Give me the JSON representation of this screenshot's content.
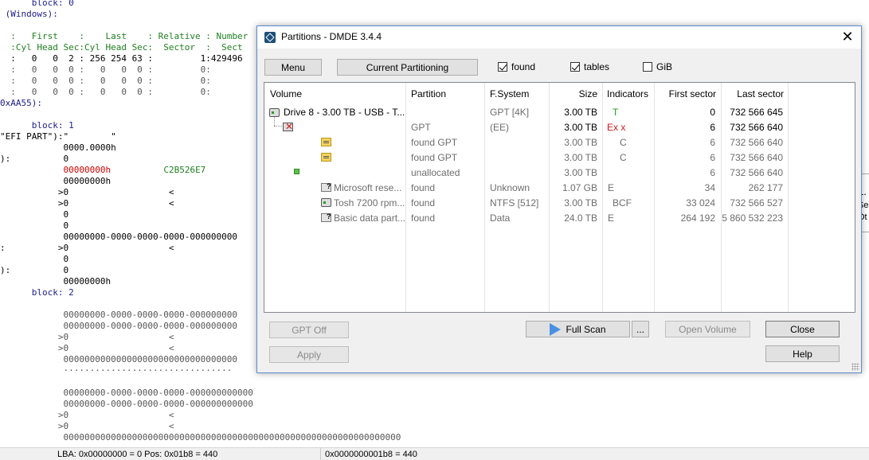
{
  "background": {
    "lines": [
      {
        "t": "      block: 0",
        "cls": "c-navy"
      },
      {
        "t": " (Windows):",
        "cls": "c-navy"
      },
      {
        "t": "",
        "cls": ""
      },
      {
        "t": "  :   First    :    Last    : Relative : Number",
        "cls": "c-green"
      },
      {
        "t": "  :Cyl Head Sec:Cyl Head Sec:  Sector  :  Sect",
        "cls": "c-green"
      },
      {
        "t": "  :   0   0  2 : 256 254 63 :         1:429496",
        "cls": ""
      },
      {
        "t": "  :   0   0  0 :   0   0  0 :         0:",
        "cls": "c-gray"
      },
      {
        "t": "  :   0   0  0 :   0   0  0 :         0:",
        "cls": "c-gray"
      },
      {
        "t": "  :   0   0  0 :   0   0  0 :         0:",
        "cls": "c-gray"
      },
      {
        "t": "0xAA55):",
        "cls": "c-navy"
      },
      {
        "t": "",
        "cls": ""
      },
      {
        "t": "      block: 1",
        "cls": "c-navy"
      },
      {
        "t": "\"EFI PART\"):\"        \"",
        "cls": ""
      },
      {
        "t": "            0000.0000h",
        "cls": ""
      },
      {
        "t": "):          0",
        "cls": ""
      },
      {
        "t": "            00000000h          C2B526E7",
        "cls": "red-line"
      },
      {
        "t": "            00000000h",
        "cls": ""
      },
      {
        "t": "           >0                   <",
        "cls": ""
      },
      {
        "t": "           >0                   <",
        "cls": ""
      },
      {
        "t": "            0",
        "cls": ""
      },
      {
        "t": "            0",
        "cls": ""
      },
      {
        "t": "            00000000-0000-0000-0000-000000000",
        "cls": ""
      },
      {
        "t": ":          >0                   <",
        "cls": ""
      },
      {
        "t": "            0",
        "cls": ""
      },
      {
        "t": "):          0",
        "cls": ""
      },
      {
        "t": "            00000000h",
        "cls": ""
      },
      {
        "t": "      block: 2",
        "cls": "c-navy"
      },
      {
        "t": "",
        "cls": ""
      },
      {
        "t": "            00000000-0000-0000-0000-000000000",
        "cls": "c-gray"
      },
      {
        "t": "            00000000-0000-0000-0000-000000000",
        "cls": "c-gray"
      },
      {
        "t": "           >0                   <",
        "cls": "c-gray"
      },
      {
        "t": "           >0                   <",
        "cls": "c-gray"
      },
      {
        "t": "            000000000000000000000000000000000",
        "cls": "c-gray"
      },
      {
        "t": "            ································",
        "cls": "c-gray"
      },
      {
        "t": "",
        "cls": ""
      },
      {
        "t": "            00000000-0000-0000-0000-000000000000",
        "cls": "c-gray"
      },
      {
        "t": "            00000000-0000-0000-0000-000000000000",
        "cls": "c-gray"
      },
      {
        "t": "           >0                   <",
        "cls": "c-gray"
      },
      {
        "t": "           >0                   <",
        "cls": "c-gray"
      },
      {
        "t": "            0000000000000000000000000000000000000000000000000000000000000000",
        "cls": "c-gray"
      }
    ],
    "status": {
      "lba": "LBA: 0x00000000 = 0  Pos: 0x01b8 = 440",
      "pos": "0x0000000001b8 = 440"
    }
  },
  "tooltip": {
    "title": "1.",
    "line1": "Sel",
    "line2": "Ot"
  },
  "dialog": {
    "title": "Partitions - DMDE 3.4.4",
    "menu_label": "Menu",
    "current_partitioning_label": "Current Partitioning",
    "found_label": "found",
    "tables_label": "tables",
    "gib_label": "GiB",
    "columns": [
      "Volume",
      "Partition",
      "F.System",
      "Size",
      "Indicators",
      "First sector",
      "Last sector"
    ],
    "rows": [
      {
        "volume": "Drive 8 - 3.00 TB - USB - T...",
        "partition": "",
        "fs": "GPT [4K]",
        "size": "3.00 TB",
        "ind": "T",
        "first": "0",
        "last": "732 566 645"
      },
      {
        "volume": "",
        "partition": "GPT",
        "fs": "(EE)",
        "size": "3.00 TB",
        "ind": "Ex x",
        "first": "6",
        "last": "732 566 640"
      },
      {
        "volume": "",
        "partition": "found GPT",
        "fs": "",
        "size": "3.00 TB",
        "ind": "C",
        "first": "6",
        "last": "732 566 640"
      },
      {
        "volume": "",
        "partition": "found GPT",
        "fs": "",
        "size": "3.00 TB",
        "ind": "C",
        "first": "6",
        "last": "732 566 640"
      },
      {
        "volume": "",
        "partition": "unallocated",
        "fs": "",
        "size": "3.00 TB",
        "ind": "",
        "first": "6",
        "last": "732 566 640"
      },
      {
        "volume": "Microsoft rese...",
        "partition": "found",
        "fs": "Unknown",
        "size": "1.07 GB",
        "ind": "E",
        "first": "34",
        "last": "262 177"
      },
      {
        "volume": "Tosh 7200 rpm...",
        "partition": "found",
        "fs": "NTFS [512]",
        "size": "3.00 TB",
        "ind": "BCF",
        "first": "33 024",
        "last": "732 566 527"
      },
      {
        "volume": "Basic data part...",
        "partition": "found",
        "fs": "Data",
        "size": "24.0 TB",
        "ind": "E",
        "first": "264 192",
        "last": "5 860 532 223"
      }
    ],
    "buttons": {
      "gpt_off": "GPT Off",
      "apply": "Apply",
      "full_scan": "Full Scan",
      "more": "...",
      "open_volume": "Open Volume",
      "close": "Close",
      "help": "Help"
    },
    "colors": {
      "indicator_green": "#1e9e1e",
      "indicator_red": "#d01818",
      "disabled_text": "#8a8a8a",
      "accent": "#4a90e2"
    }
  }
}
